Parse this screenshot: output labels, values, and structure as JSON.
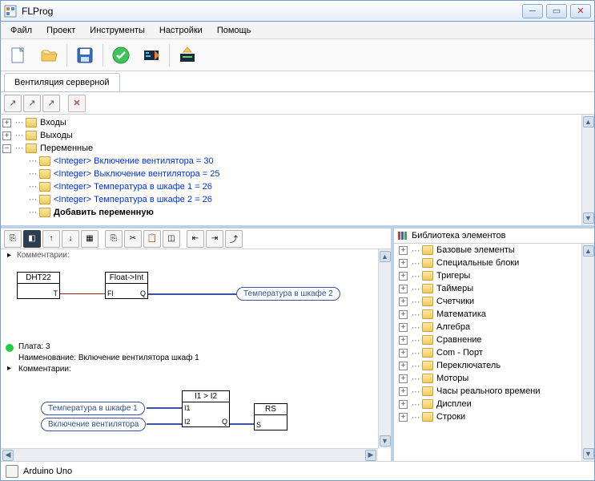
{
  "window": {
    "title": "FLProg"
  },
  "menu": {
    "file": "Файл",
    "project": "Проект",
    "tools": "Инструменты",
    "settings": "Настройки",
    "help": "Помощь"
  },
  "tab": {
    "name": "Вентиляция серверной"
  },
  "tree": {
    "inputs": "Входы",
    "outputs": "Выходы",
    "variables": "Переменные",
    "var1": "<Integer> Включение вентилятора = 30",
    "var2": "<Integer> Выключение вентилятора = 25",
    "var3": "<Integer> Температура в шкафе 1 = 26",
    "var4": "<Integer> Температура в шкафе 2 = 26",
    "addvar": "Добавить переменную"
  },
  "canvas": {
    "comments_top": "Комментарии:",
    "block_dht": "DHT22",
    "block_float": "Float->Int",
    "oval_temp2": "Температура в шкафе 2",
    "plata": "Плата: 3",
    "naim": "Наименование: Включение вентилятора шкаф 1",
    "comments2": "Комментарии:",
    "oval_temp1": "Температура в шкафе 1",
    "oval_fanon": "Включение вентилятора",
    "block_cmp": "I1 > I2",
    "port_i1": "I1",
    "port_i2": "I2",
    "port_q": "Q",
    "port_fl": "Fl",
    "port_t": "T",
    "block_rs": "RS",
    "port_s": "S"
  },
  "library": {
    "header": "Библиотека элементов",
    "items": [
      "Базовые элементы",
      "Специальные блоки",
      "Тригеры",
      "Таймеры",
      "Счетчики",
      "Математика",
      "Алгебра",
      "Сравнение",
      "Com - Порт",
      "Переключатель",
      "Моторы",
      "Часы реального времени",
      "Дисплеи",
      "Строки"
    ]
  },
  "status": {
    "board": "Arduino Uno"
  }
}
